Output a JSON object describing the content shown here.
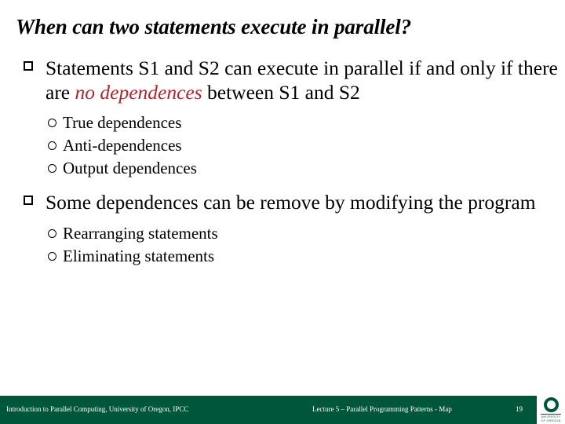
{
  "slide": {
    "title": "When can two statements execute in parallel?",
    "bullets": [
      {
        "marker": "hollow-square",
        "text_before": "Statements S1 and S2 can execute in parallel if and only if there are ",
        "emphasis": "no dependences",
        "emphasis_color": "#B0232A",
        "text_after": " between S1 and S2",
        "sub_bullets": [
          {
            "marker": "hollow-circle",
            "text": "True dependences"
          },
          {
            "marker": "hollow-circle",
            "text": "Anti-dependences"
          },
          {
            "marker": "hollow-circle",
            "text": "Output dependences"
          }
        ]
      },
      {
        "marker": "hollow-square",
        "text": "Some dependences can be remove by modifying the program",
        "sub_bullets": [
          {
            "marker": "hollow-circle",
            "text": "Rearranging statements"
          },
          {
            "marker": "hollow-circle",
            "text": "Eliminating statements"
          }
        ]
      }
    ]
  },
  "footer": {
    "background_color": "#00563B",
    "text_color": "#FFFFFF",
    "left": "Introduction to Parallel Computing, University of Oregon, IPCC",
    "center": "Lecture 5 – Parallel Programming Patterns - Map",
    "page_number": "19",
    "logo": {
      "glyph": "O",
      "caption_line1": "UNIVERSITY",
      "caption_line2": "OF OREGON",
      "color": "#00563B"
    }
  }
}
